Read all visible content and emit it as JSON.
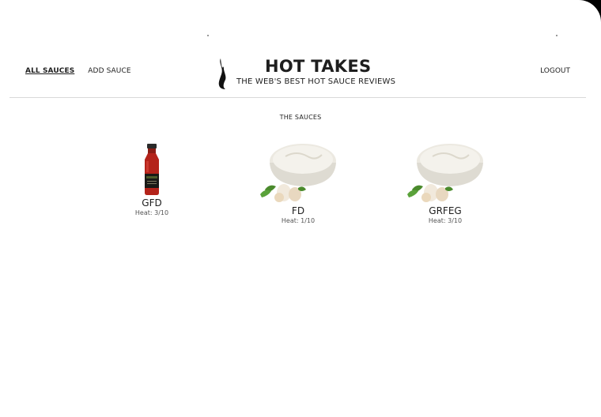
{
  "nav": {
    "all_sauces": "ALL SAUCES",
    "add_sauce": "ADD SAUCE",
    "logout": "LOGOUT"
  },
  "brand": {
    "title": "HOT TAKES",
    "subtitle": "THE WEB'S BEST HOT SAUCE REVIEWS"
  },
  "section_title": "THE SAUCES",
  "sauces": [
    {
      "name": "GFD",
      "heat": "Heat: 3/10",
      "image": "red-sauce-bottle"
    },
    {
      "name": "FD",
      "heat": "Heat: 1/10",
      "image": "garlic-sauce-bowl"
    },
    {
      "name": "GRFEG",
      "heat": "Heat: 3/10",
      "image": "garlic-sauce-bowl"
    }
  ],
  "colors": {
    "text": "#1e1e1e",
    "divider": "#d9d9d9",
    "bottle_red": "#b4231a"
  }
}
